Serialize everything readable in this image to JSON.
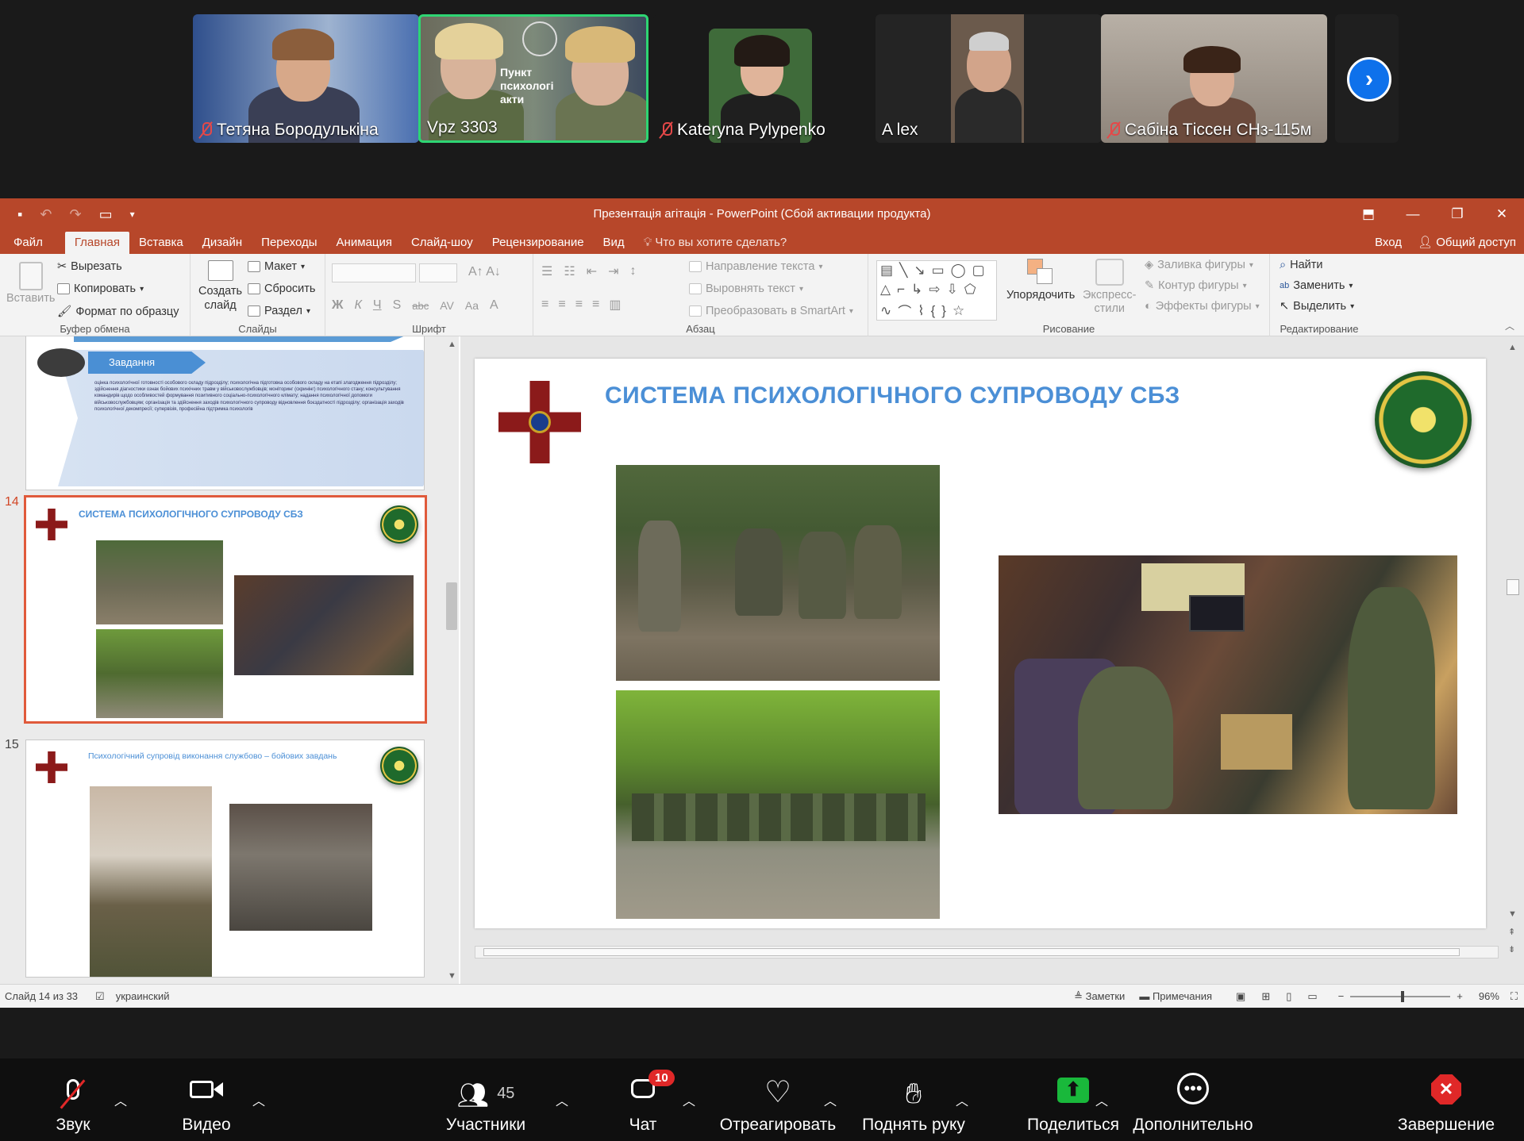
{
  "participants": [
    {
      "name": "Тетяна Бородулькіна",
      "muted": true
    },
    {
      "name": "Vpz 3303",
      "muted": false,
      "overlay": "Пункт психологі акти"
    },
    {
      "name": "Kateryna Pylypenko",
      "muted": true
    },
    {
      "name": "A lex",
      "muted": false
    },
    {
      "name": "Сабіна Тіссен СНз-115м",
      "muted": true
    }
  ],
  "ppt": {
    "window_title": "Презентація агітація - PowerPoint (Сбой активации продукта)",
    "tabs": [
      "Файл",
      "Главная",
      "Вставка",
      "Дизайн",
      "Переходы",
      "Анимация",
      "Слайд-шоу",
      "Рецензирование",
      "Вид"
    ],
    "selected_tab": "Главная",
    "tell_me": "Что вы хотите сделать?",
    "signin": "Вход",
    "share": "Общий доступ",
    "ribbon": {
      "clipboard": {
        "paste": "Вставить",
        "cut": "Вырезать",
        "copy": "Копировать",
        "format_painter": "Формат по образцу",
        "label": "Буфер обмена"
      },
      "slides": {
        "new_slide_1": "Создать",
        "new_slide_2": "слайд",
        "layout": "Макет",
        "reset": "Сбросить",
        "section": "Раздел",
        "label": "Слайды"
      },
      "font": {
        "label": "Шрифт",
        "bold": "Ж",
        "italic": "К",
        "underline": "Ч",
        "strike": "S",
        "abc": "abc",
        "av": "AV",
        "aa": "Aa",
        "a": "A"
      },
      "paragraph": {
        "text_direction": "Направление текста",
        "align_text": "Выровнять текст",
        "smartart": "Преобразовать в SmartArt",
        "label": "Абзац"
      },
      "drawing": {
        "arrange": "Упорядочить",
        "quick_styles_1": "Экспресс-",
        "quick_styles_2": "стили",
        "fill": "Заливка фигуры",
        "outline": "Контур фигуры",
        "effects": "Эффекты фигуры",
        "label": "Рисование"
      },
      "editing": {
        "find": "Найти",
        "replace": "Заменить",
        "select": "Выделить",
        "label": "Редактирование"
      }
    },
    "thumbnails": [
      {
        "num": "",
        "title": "Завдання",
        "bullets_text": "оцінка психологічної готовності особового складу підрозділу; психологічна підготовка особового складу на етапі злагодження підрозділу; здійснення діагностики ознак бойових психічних травм у військовослужбовців; моніторинг (скринінг) психологічного стану; консультування командирів щодо особливостей формування позитивного соціально-психологічного клімату; надання психологічної допомоги військовослужбовцям; організація та здійснення заходів психологічного супроводу відновлення боєздатності підрозділу; організація заходів психологічної декомпресії; супервізія, професійна підтримка психологів"
      },
      {
        "num": "14",
        "title": "СИСТЕМА ПСИХОЛОГІЧНОГО СУПРОВОДУ СБЗ",
        "selected": true
      },
      {
        "num": "15",
        "title": "Психологічний супровід виконання службово – бойових завдань"
      }
    ],
    "slide": {
      "title": "СИСТЕМА ПСИХОЛОГІЧНОГО СУПРОВОДУ СБЗ"
    },
    "status": {
      "slide_counter": "Слайд 14 из 33",
      "language": "украинский",
      "notes": "Заметки",
      "comments": "Примечания",
      "zoom": "96%"
    }
  },
  "toolbar": {
    "audio": "Звук",
    "video": "Видео",
    "participants": "Участники",
    "participants_count": "45",
    "chat": "Чат",
    "chat_badge": "10",
    "react": "Отреагировать",
    "raise_hand": "Поднять руку",
    "share": "Поделиться",
    "more": "Дополнительно",
    "end": "Завершение"
  },
  "colors": {
    "ppt_accent": "#b7472a",
    "active_speaker": "#2ed573",
    "share_green": "#19b83b",
    "end_red": "#e02828",
    "slide_title": "#4b8fd6"
  }
}
